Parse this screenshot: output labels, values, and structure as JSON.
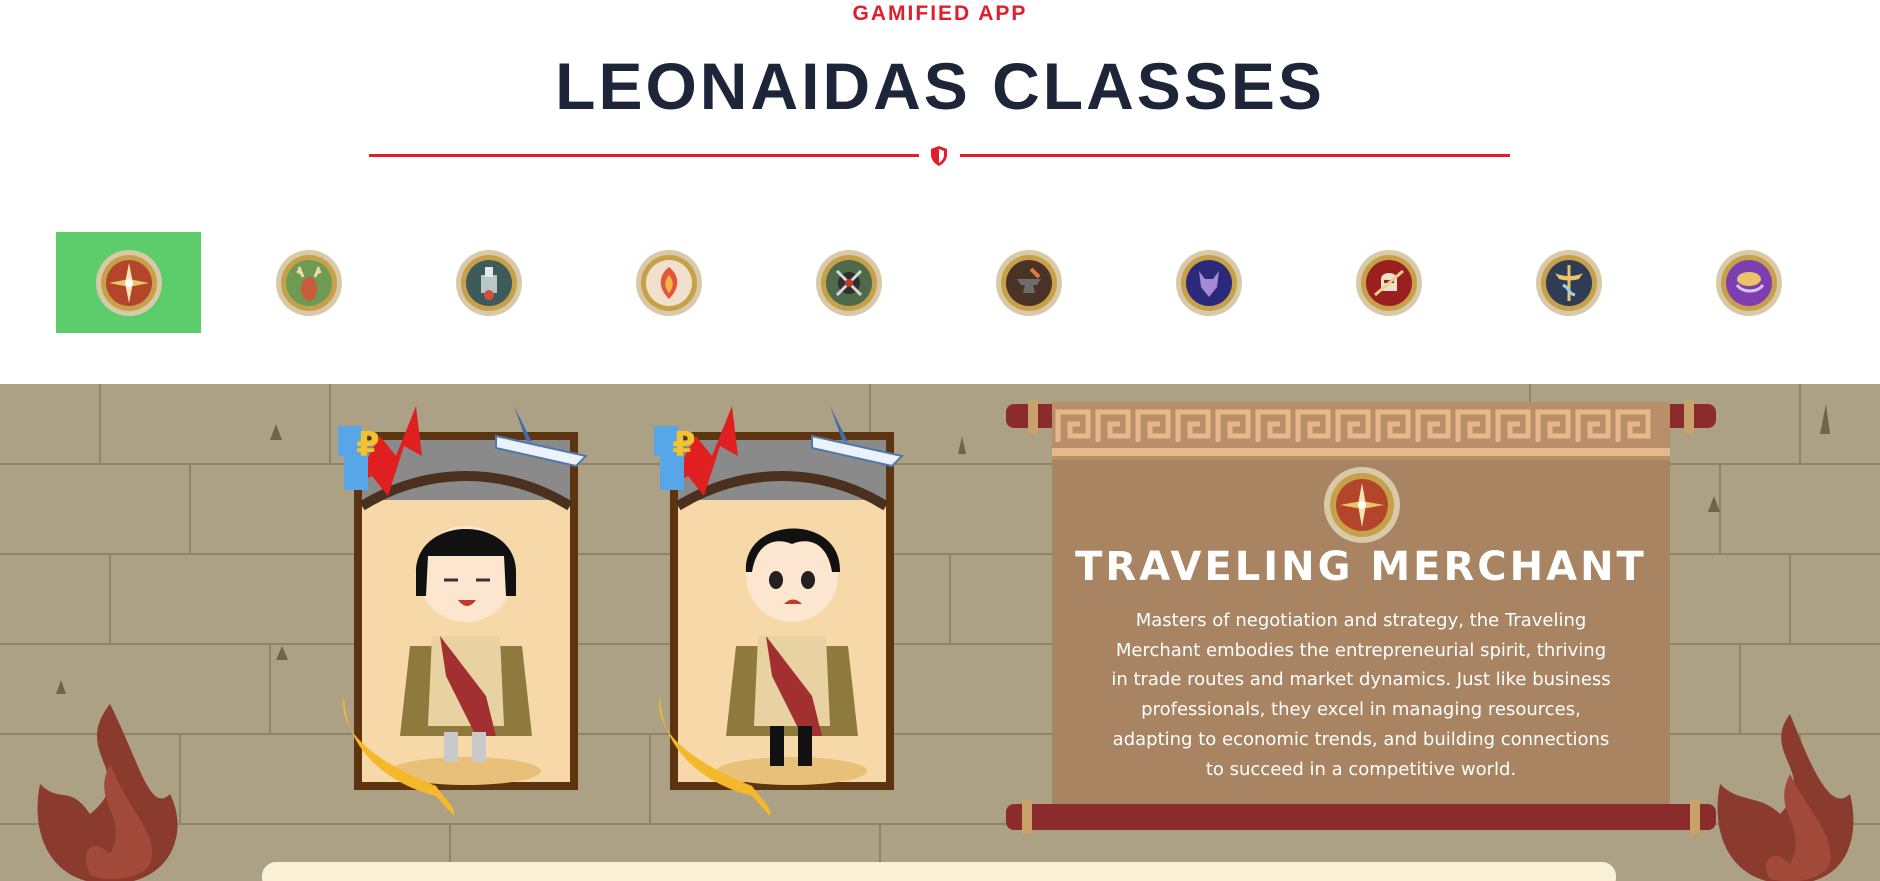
{
  "header": {
    "eyebrow": "GAMIFIED APP",
    "title": "LEONAIDAS CLASSES"
  },
  "class_tabs": [
    {
      "icon": "compass-icon",
      "selected": true
    },
    {
      "icon": "deer-icon",
      "selected": false
    },
    {
      "icon": "laboratory-icon",
      "selected": false
    },
    {
      "icon": "phoenix-icon",
      "selected": false
    },
    {
      "icon": "crossed-swords-icon",
      "selected": false
    },
    {
      "icon": "anvil-icon",
      "selected": false
    },
    {
      "icon": "wolf-icon",
      "selected": false
    },
    {
      "icon": "knight-helmet-icon",
      "selected": false
    },
    {
      "icon": "caduceus-icon",
      "selected": false
    },
    {
      "icon": "genie-lamp-icon",
      "selected": false
    }
  ],
  "selected_class": {
    "name": "TRAVELING MERCHANT",
    "description": "Masters of negotiation and strategy, the Traveling Merchant embodies the entrepreneurial spirit, thriving in trade routes and market dynamics. Just like business professionals, they excel in managing resources, adapting to economic trends, and building connections to succeed in a competitive world.",
    "icon": "compass-icon"
  },
  "characters": [
    {
      "name": "female-merchant-card"
    },
    {
      "name": "male-merchant-card"
    }
  ],
  "colors": {
    "accent_red": "#e11d2e",
    "title_navy": "#1d2638",
    "tab_active_green": "#5dcd6b",
    "wall": "#aca184",
    "scroll_parchment": "#a88462",
    "scroll_rod": "#8c2b2b"
  }
}
